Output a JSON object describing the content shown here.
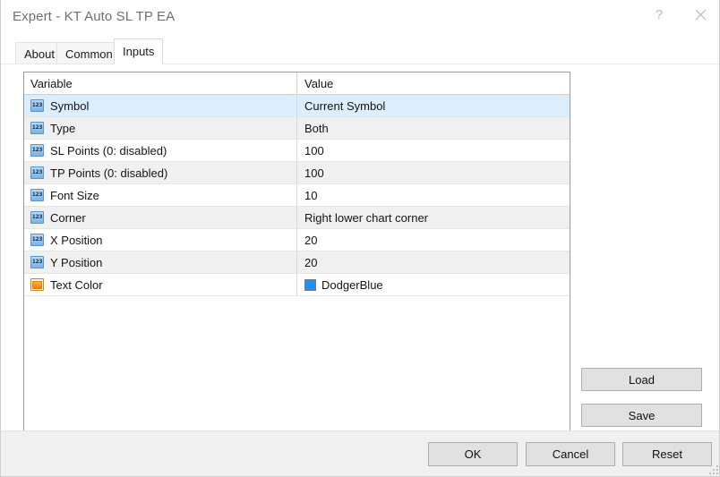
{
  "window": {
    "title": "Expert - KT Auto SL TP EA",
    "help_label": "?",
    "close_label": "✕"
  },
  "tabs": [
    {
      "label": "About",
      "active": false
    },
    {
      "label": "Common",
      "active": false
    },
    {
      "label": "Inputs",
      "active": true
    }
  ],
  "table": {
    "columns": [
      "Variable",
      "Value"
    ],
    "rows": [
      {
        "icon": "numeric-123-icon",
        "variable": "Symbol",
        "value": "Current Symbol",
        "selected": true
      },
      {
        "icon": "numeric-123-icon",
        "variable": "Type",
        "value": "Both",
        "selected": false
      },
      {
        "icon": "numeric-123-icon",
        "variable": "SL Points (0: disabled)",
        "value": "100",
        "selected": false
      },
      {
        "icon": "numeric-123-icon",
        "variable": "TP Points (0: disabled)",
        "value": "100",
        "selected": false
      },
      {
        "icon": "numeric-123-icon",
        "variable": "Font Size",
        "value": "10",
        "selected": false
      },
      {
        "icon": "numeric-123-icon",
        "variable": "Corner",
        "value": "Right lower chart corner",
        "selected": false
      },
      {
        "icon": "numeric-123-icon",
        "variable": "X Position",
        "value": "20",
        "selected": false
      },
      {
        "icon": "numeric-123-icon",
        "variable": "Y Position",
        "value": "20",
        "selected": false
      },
      {
        "icon": "color-swatch-icon",
        "variable": "Text Color",
        "value": "DodgerBlue",
        "selected": false,
        "swatch": "#1E90FF"
      }
    ]
  },
  "side_buttons": {
    "load_label": "Load",
    "save_label": "Save"
  },
  "bottom_buttons": {
    "ok_label": "OK",
    "cancel_label": "Cancel",
    "reset_label": "Reset"
  },
  "colors": {
    "selected_row": "#DCEDFB",
    "alt_row": "#F0F0F0",
    "dodger_blue": "#1E90FF",
    "title_text": "#6F6F6F"
  }
}
